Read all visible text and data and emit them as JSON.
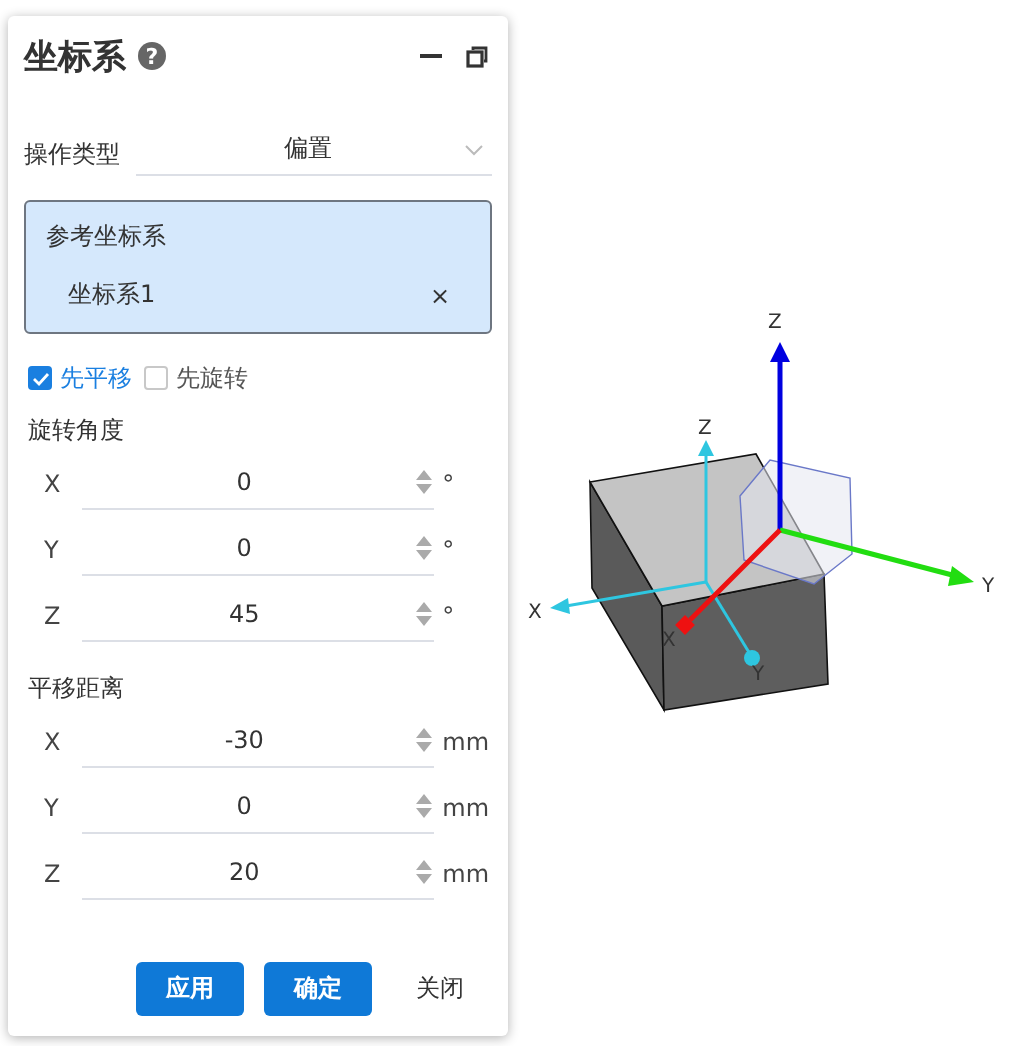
{
  "panel": {
    "title": "坐标系",
    "help": "?"
  },
  "operation_type": {
    "label": "操作类型",
    "value": "偏置"
  },
  "reference": {
    "label": "参考坐标系",
    "value": "坐标系1",
    "clear": "×"
  },
  "options": [
    {
      "label": "先平移",
      "checked": true
    },
    {
      "label": "先旋转",
      "checked": false
    }
  ],
  "rotation": {
    "label": "旋转角度",
    "rows": [
      {
        "axis": "X",
        "value": "0",
        "unit": "°"
      },
      {
        "axis": "Y",
        "value": "0",
        "unit": "°"
      },
      {
        "axis": "Z",
        "value": "45",
        "unit": "°"
      }
    ]
  },
  "translation": {
    "label": "平移距离",
    "rows": [
      {
        "axis": "X",
        "value": "-30",
        "unit": "mm"
      },
      {
        "axis": "Y",
        "value": "0",
        "unit": "mm"
      },
      {
        "axis": "Z",
        "value": "20",
        "unit": "mm"
      }
    ]
  },
  "buttons": [
    {
      "label": "应用",
      "kind": "primary"
    },
    {
      "label": "确定",
      "kind": "primary"
    },
    {
      "label": "关闭",
      "kind": "plain"
    }
  ],
  "viewport": {
    "global_axes": [
      "X",
      "Y",
      "Z"
    ],
    "local_axes": [
      "X",
      "Y",
      "Z"
    ]
  }
}
